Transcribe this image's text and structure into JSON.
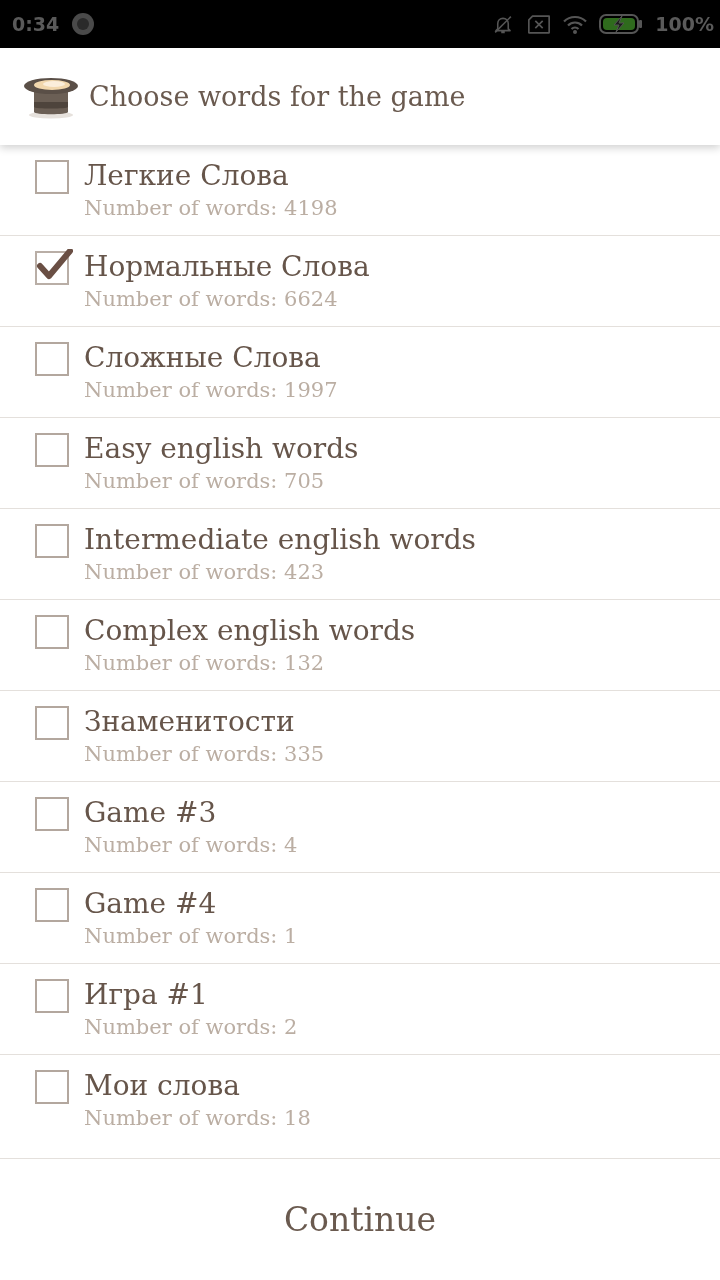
{
  "status_bar": {
    "time": "0:34",
    "battery_text": "100%"
  },
  "header": {
    "title": "Choose words for the game"
  },
  "word_sets": [
    {
      "name": "Легкие Слова",
      "count": "Number of words: 4198",
      "checked": false
    },
    {
      "name": "Нормальные Слова",
      "count": "Number of words: 6624",
      "checked": true
    },
    {
      "name": "Сложные Слова",
      "count": "Number of words: 1997",
      "checked": false
    },
    {
      "name": "Easy english words",
      "count": "Number of words: 705",
      "checked": false
    },
    {
      "name": "Intermediate english words",
      "count": "Number of words: 423",
      "checked": false
    },
    {
      "name": "Complex english words",
      "count": "Number of words: 132",
      "checked": false
    },
    {
      "name": "Знаменитости",
      "count": "Number of words: 335",
      "checked": false
    },
    {
      "name": "Game #3",
      "count": "Number of words: 4",
      "checked": false
    },
    {
      "name": "Game #4",
      "count": "Number of words: 1",
      "checked": false
    },
    {
      "name": "Игра #1",
      "count": "Number of words: 2",
      "checked": false
    },
    {
      "name": "Мои слова",
      "count": "Number of words: 18",
      "checked": false
    }
  ],
  "continue_button": {
    "label": "Continue"
  }
}
